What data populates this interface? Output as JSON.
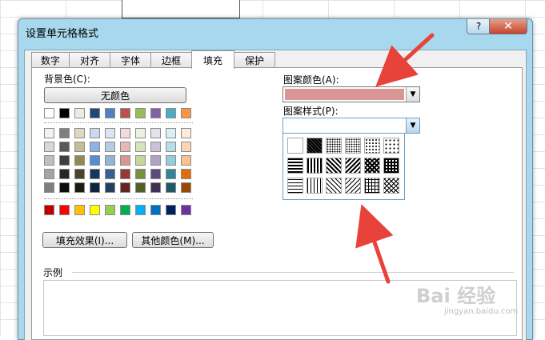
{
  "dialog": {
    "title": "设置单元格格式",
    "help": "?",
    "close": "✕"
  },
  "tabs": [
    {
      "label": "数字"
    },
    {
      "label": "对齐"
    },
    {
      "label": "字体"
    },
    {
      "label": "边框"
    },
    {
      "label": "填充",
      "active": true
    },
    {
      "label": "保护"
    }
  ],
  "fill": {
    "bg_label": "背景色(C):",
    "no_color_button": "无颜色",
    "theme_top_row": [
      "#ffffff",
      "#000000",
      "#eeece1",
      "#1f497d",
      "#4f81bd",
      "#c0504d",
      "#9bbb59",
      "#8064a2",
      "#4bacc6",
      "#f79646"
    ],
    "theme_shades": [
      [
        "#f2f2f2",
        "#7f7f7f",
        "#ddd9c3",
        "#c6d9f0",
        "#dbe5f1",
        "#f2dcdb",
        "#ebf1dd",
        "#e5e0ec",
        "#dbeef3",
        "#fdeada"
      ],
      [
        "#d8d8d8",
        "#595959",
        "#c4bd97",
        "#8db3e2",
        "#b8cce4",
        "#e5b9b7",
        "#d7e3bc",
        "#ccc1d9",
        "#b7dde8",
        "#fbd5b5"
      ],
      [
        "#bfbfbf",
        "#3f3f3f",
        "#938953",
        "#548dd4",
        "#95b3d7",
        "#d99694",
        "#c3d69b",
        "#b2a2c7",
        "#92cddc",
        "#fac08f"
      ],
      [
        "#a5a5a5",
        "#262626",
        "#494429",
        "#17365d",
        "#366092",
        "#953734",
        "#76923c",
        "#5f497a",
        "#31859b",
        "#e36c09"
      ],
      [
        "#7f7f7f",
        "#0c0c0c",
        "#1d1b10",
        "#0f243e",
        "#244061",
        "#632423",
        "#4f6128",
        "#3f3151",
        "#205867",
        "#974806"
      ]
    ],
    "standard_colors": [
      "#c00000",
      "#ff0000",
      "#ffc000",
      "#ffff00",
      "#92d050",
      "#00b050",
      "#00b0f0",
      "#0070c0",
      "#002060",
      "#7030a0"
    ],
    "fill_effects_button": "填充效果(I)...",
    "more_colors_button": "其他颜色(M)...",
    "pattern_color_label": "图案颜色(A):",
    "pattern_color_value": "#da9694",
    "pattern_style_label": "图案样式(P):",
    "sample_label": "示例"
  },
  "patterns": [
    "solid",
    "dark-gray",
    "medium-gray",
    "light-gray",
    "gray-125",
    "gray-0625",
    "thick-horizontal",
    "thick-vertical",
    "thick-reverse-diagonal",
    "thick-diagonal",
    "thick-diagonal-crosshatch",
    "thick-grid",
    "thin-horizontal",
    "thin-vertical",
    "thin-reverse-diagonal",
    "thin-diagonal",
    "thin-grid",
    "thin-diagonal-crosshatch"
  ],
  "watermark": {
    "main": "Bai 经验",
    "sub": "jingyan.baidu.com"
  },
  "colors": {
    "arrow": "#e8433a",
    "selection": "#6e9cc5"
  }
}
